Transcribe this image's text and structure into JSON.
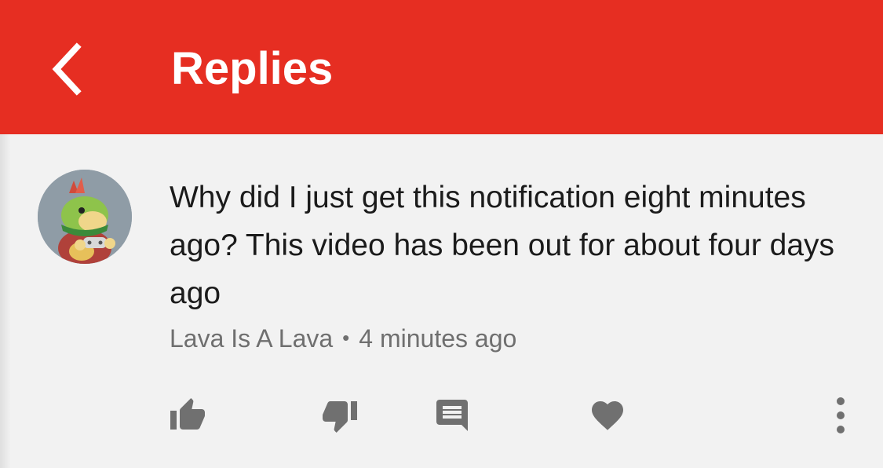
{
  "header": {
    "title": "Replies",
    "back_icon": "chevron-left-icon"
  },
  "colors": {
    "header_bg": "#e62e22",
    "page_bg": "#f2f2f2",
    "icon": "#707070"
  },
  "comment": {
    "avatar_icon": "avatar-image",
    "text": "Why did I just get this notification eight minutes ago? This video has been out for about four days ago",
    "author": "Lava Is A Lava",
    "separator": "•",
    "time": "4 minutes ago"
  },
  "actions": [
    {
      "name": "like",
      "icon": "thumbs-up-icon"
    },
    {
      "name": "dislike",
      "icon": "thumbs-down-icon"
    },
    {
      "name": "reply",
      "icon": "comment-icon"
    },
    {
      "name": "heart",
      "icon": "heart-icon"
    },
    {
      "name": "more",
      "icon": "more-vertical-icon"
    }
  ]
}
